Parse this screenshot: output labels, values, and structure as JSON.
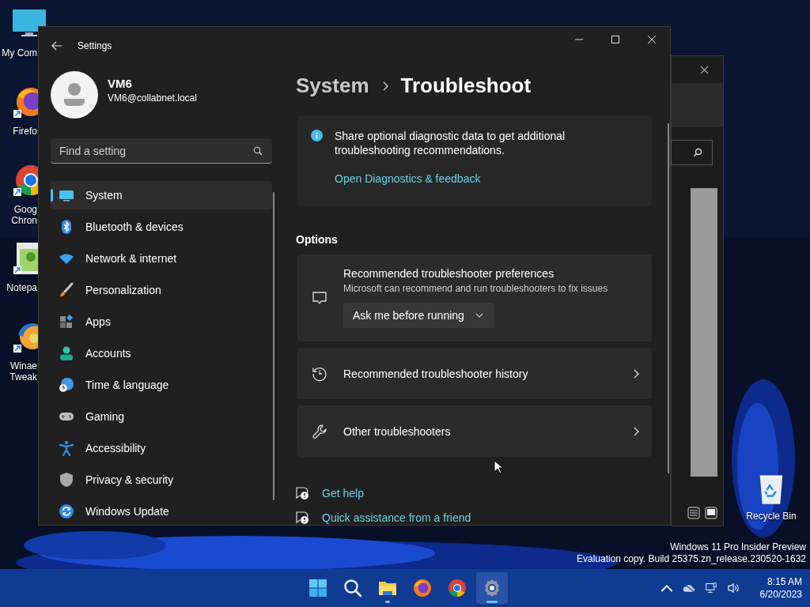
{
  "desktop_icons": [
    {
      "kind": "computer",
      "lines": [
        "My Com"
      ]
    },
    {
      "kind": "firefox",
      "lines": [
        "Firefo"
      ]
    },
    {
      "kind": "chrome",
      "lines": [
        "Goog",
        "Chron"
      ]
    },
    {
      "kind": "notepad",
      "lines": [
        "Notepa"
      ]
    },
    {
      "kind": "winaero",
      "lines": [
        "Winae",
        "Tweak"
      ]
    }
  ],
  "recycle_bin": {
    "label": "Recycle Bin"
  },
  "system_notice": [
    "Windows 11 Pro Insider Preview",
    "Evaluation copy. Build 25375.zn_release.230520-1632"
  ],
  "settings_window": {
    "title": "Settings",
    "user": {
      "name": "VM6",
      "email": "VM6@collabnet.local"
    },
    "search": {
      "placeholder": "Find a setting"
    },
    "nav": [
      {
        "kind": "system",
        "label": "System",
        "selected": true
      },
      {
        "kind": "bluetooth",
        "label": "Bluetooth & devices",
        "selected": false
      },
      {
        "kind": "network",
        "label": "Network & internet",
        "selected": false
      },
      {
        "kind": "personalization",
        "label": "Personalization",
        "selected": false
      },
      {
        "kind": "apps",
        "label": "Apps",
        "selected": false
      },
      {
        "kind": "accounts",
        "label": "Accounts",
        "selected": false
      },
      {
        "kind": "time",
        "label": "Time & language",
        "selected": false
      },
      {
        "kind": "gaming",
        "label": "Gaming",
        "selected": false
      },
      {
        "kind": "accessibility",
        "label": "Accessibility",
        "selected": false
      },
      {
        "kind": "privacy",
        "label": "Privacy & security",
        "selected": false
      },
      {
        "kind": "update",
        "label": "Windows Update",
        "selected": false
      }
    ],
    "breadcrumb": [
      "System",
      "Troubleshoot"
    ],
    "info": {
      "text": "Share optional diagnostic data to get additional troubleshooting recommendations.",
      "link": "Open Diagnostics & feedback"
    },
    "section": "Options",
    "options": [
      {
        "kind": "dropdown",
        "title": "Recommended troubleshooter preferences",
        "description": "Microsoft can recommend and run troubleshooters to fix issues",
        "value": "Ask me before running"
      },
      {
        "kind": "link",
        "title": "Recommended troubleshooter history"
      },
      {
        "kind": "link",
        "title": "Other troubleshooters"
      }
    ],
    "help_links": [
      "Get help",
      "Quick assistance from a friend"
    ]
  },
  "taskbar": {
    "apps": [
      {
        "kind": "start",
        "selected": false,
        "running": false
      },
      {
        "kind": "search",
        "selected": false,
        "running": false
      },
      {
        "kind": "explorer",
        "selected": false,
        "running": true
      },
      {
        "kind": "firefox",
        "selected": false,
        "running": false
      },
      {
        "kind": "chrome",
        "selected": false,
        "running": false
      },
      {
        "kind": "settings",
        "selected": true,
        "running": true
      }
    ],
    "clock": {
      "time": "8:15 AM",
      "date": "6/20/2023"
    }
  }
}
